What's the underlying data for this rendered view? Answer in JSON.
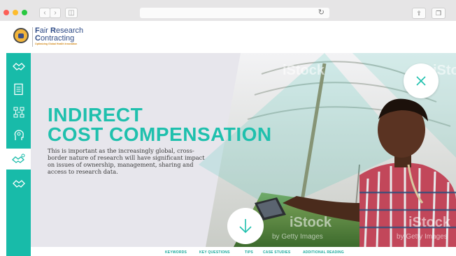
{
  "browser": {
    "back_icon": "chevron-left-icon",
    "forward_icon": "chevron-right-icon",
    "sidebar_toggle_icon": "sidebar-icon",
    "reload_icon": "reload-icon",
    "share_icon": "share-icon",
    "tabs_icon": "tabs-icon"
  },
  "logo": {
    "line1_initial": "F",
    "line1_rest": "air ",
    "line1_word_initial": "R",
    "line1_word_rest": "esearch",
    "line2_initial": "C",
    "line2_rest": "ontracting",
    "tagline": "Optimizing Global Health Innovation"
  },
  "sidebar": {
    "items": [
      {
        "icon": "handshake-icon"
      },
      {
        "icon": "document-icon"
      },
      {
        "icon": "network-icon"
      },
      {
        "icon": "head-gears-icon"
      },
      {
        "icon": "handshake-money-icon",
        "active": true
      },
      {
        "icon": "handshake-icon"
      }
    ]
  },
  "hero": {
    "title_line1": "INDIRECT",
    "title_line2": "COST COMPENSATION",
    "body": "This is important as the increasingly global, cross-border nature of research will have significant impact on issues of ownership, management, sharing and access to research data.",
    "watermark_1": "iStock",
    "watermark_2": "iStock",
    "watermark_3": "iStock",
    "watermark_4": "iStock",
    "watermark_sub_1": "by Getty Images",
    "watermark_sub_2": "by Getty Images",
    "close_icon": "close-icon",
    "down_icon": "arrow-down-icon"
  },
  "footer_nav": [
    "KEYWORDS",
    "KEY QUESTIONS",
    "TIPS",
    "CASE STUDIES",
    "ADDITIONAL READING"
  ],
  "colors": {
    "accent": "#1fc0ad",
    "sidebar": "#18bba9",
    "brand_blue": "#2d4a86",
    "brand_gold": "#f2b53c"
  }
}
